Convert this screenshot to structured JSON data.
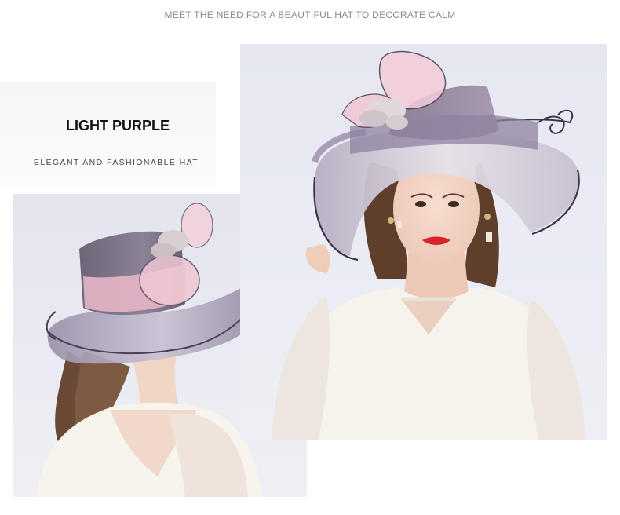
{
  "header": {
    "tagline": "MEET THE NEED FOR A BEAUTIFUL HAT TO DECORATE CALM"
  },
  "product": {
    "color_name": "LIGHT PURPLE",
    "description": "ELEGANT AND FASHIONABLE HAT"
  },
  "colors": {
    "hat_purple": "#7d7188",
    "hat_pink": "#e7b8c8",
    "photo_background": "#e9e9f3",
    "dress": "#f6f3ec"
  },
  "photos": [
    {
      "view": "back-three-quarter",
      "subject": "woman-wearing-hat-back-view"
    },
    {
      "view": "front",
      "subject": "woman-wearing-hat-front-view"
    }
  ]
}
